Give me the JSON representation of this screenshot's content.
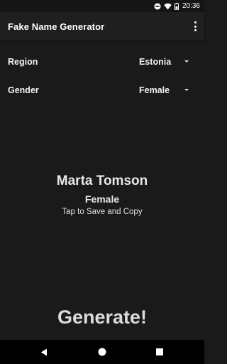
{
  "status_bar": {
    "time": "20:36",
    "icons": [
      "do-not-disturb-icon",
      "wifi-icon",
      "battery-icon"
    ]
  },
  "app_bar": {
    "title": "Fake Name Generator",
    "menu_icon": "overflow-menu-icon"
  },
  "settings": {
    "region": {
      "label": "Region",
      "value": "Estonia"
    },
    "gender": {
      "label": "Gender",
      "value": "Female"
    }
  },
  "result": {
    "name": "Marta Tomson",
    "gender": "Female",
    "hint": "Tap to Save and Copy"
  },
  "generate_button": {
    "label": "Generate!"
  },
  "nav_bar": {
    "icons": [
      "back-icon",
      "home-icon",
      "recents-icon"
    ]
  },
  "colors": {
    "background": "#1a1a1a",
    "app_bar": "#1f1f1f",
    "text": "#ffffff",
    "nav_bar": "#000000"
  }
}
